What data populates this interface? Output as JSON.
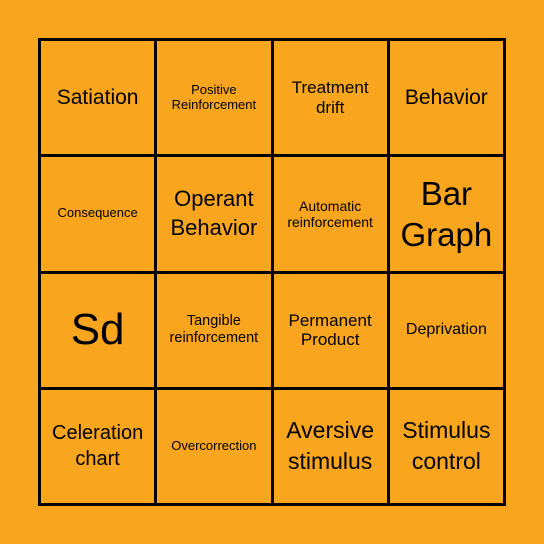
{
  "colors": {
    "background": "#F9A61E",
    "cell": "#F9A61E",
    "grid_lines": "#000000",
    "text": "#000000"
  },
  "board": {
    "rows": 4,
    "columns": 4,
    "cells": [
      {
        "text": "Satiation"
      },
      {
        "text": "Positive Reinforcement"
      },
      {
        "text": "Treatment drift"
      },
      {
        "text": "Behavior"
      },
      {
        "text": "Consequence"
      },
      {
        "text": "Operant Behavior"
      },
      {
        "text": "Automatic reinforcement"
      },
      {
        "text": "Bar Graph"
      },
      {
        "text": "Sd"
      },
      {
        "text": "Tangible reinforcement"
      },
      {
        "text": "Permanent Product"
      },
      {
        "text": "Deprivation"
      },
      {
        "text": "Celeration chart"
      },
      {
        "text": "Overcorrection"
      },
      {
        "text": "Aversive stimulus"
      },
      {
        "text": "Stimulus control"
      }
    ]
  }
}
